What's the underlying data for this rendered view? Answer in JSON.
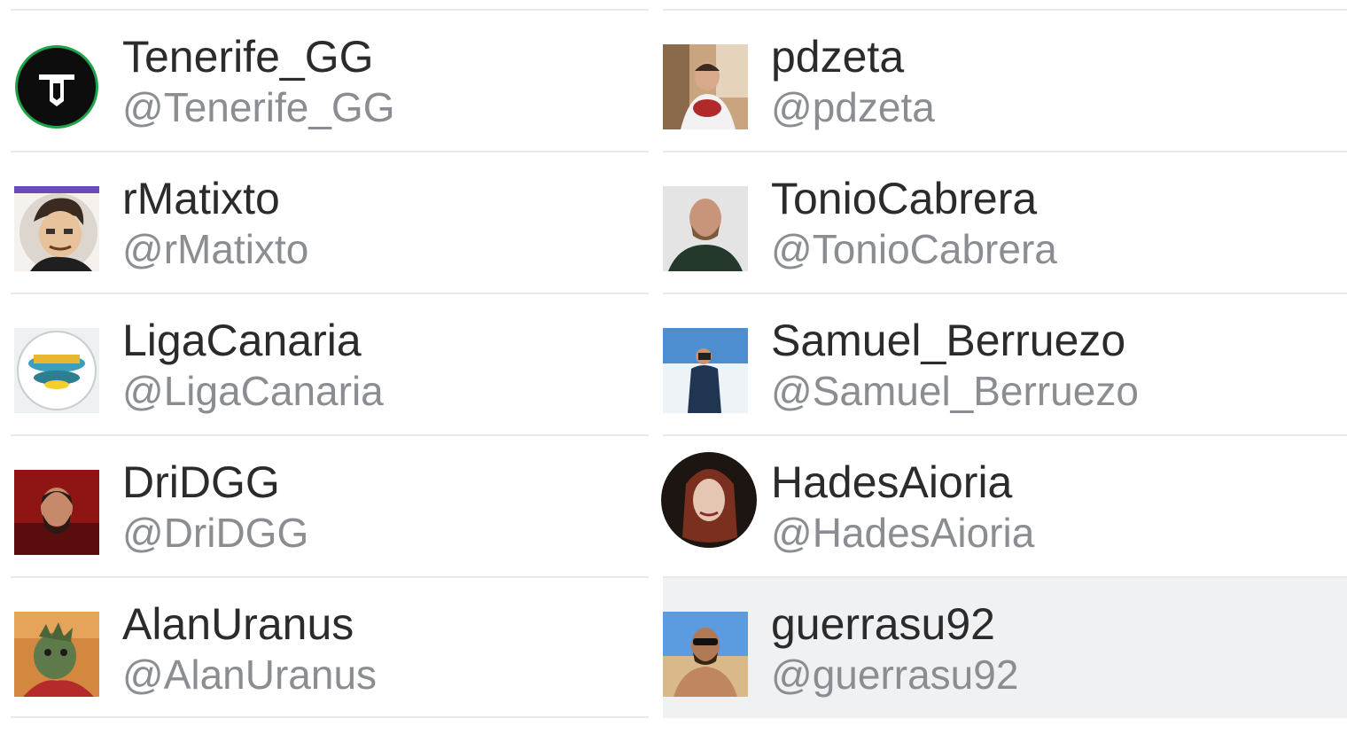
{
  "users": [
    {
      "name": "Tenerife_GG",
      "handle": "@Tenerife_GG",
      "avatar_icon": "tenerife-gg-logo",
      "accent": "#111111"
    },
    {
      "name": "pdzeta",
      "handle": "@pdzeta",
      "avatar_icon": "person-photo",
      "accent": "#b33a3a"
    },
    {
      "name": "rMatixto",
      "handle": "@rMatixto",
      "avatar_icon": "cartoon-avatar",
      "accent": "#6a4bb8"
    },
    {
      "name": "TonioCabrera",
      "handle": "@TonioCabrera",
      "avatar_icon": "person-photo",
      "accent": "#2e4a35"
    },
    {
      "name": "LigaCanaria",
      "handle": "@LigaCanaria",
      "avatar_icon": "league-logo",
      "accent": "#2f9bb0"
    },
    {
      "name": "Samuel_Berruezo",
      "handle": "@Samuel_Berruezo",
      "avatar_icon": "person-photo",
      "accent": "#3f83c9"
    },
    {
      "name": "DriDGG",
      "handle": "@DriDGG",
      "avatar_icon": "person-photo",
      "accent": "#a31c1c"
    },
    {
      "name": "HadesAioria",
      "handle": "@HadesAioria",
      "avatar_icon": "illustrated-avatar",
      "accent": "#6b2d1f"
    },
    {
      "name": "AlanUranus",
      "handle": "@AlanUranus",
      "avatar_icon": "costume-photo",
      "accent": "#c0702e"
    },
    {
      "name": "guerrasu92",
      "handle": "@guerrasu92",
      "avatar_icon": "person-photo",
      "accent": "#4a8fd1"
    }
  ]
}
